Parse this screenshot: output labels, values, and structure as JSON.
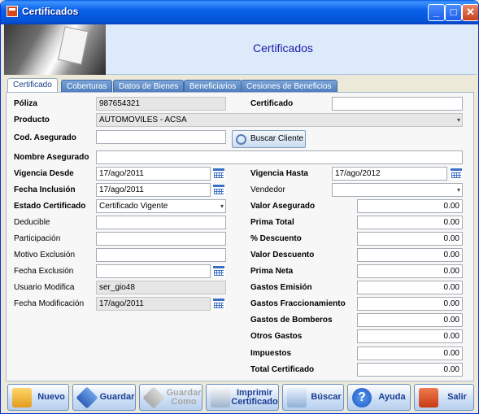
{
  "window": {
    "title": "Certificados"
  },
  "header": {
    "title": "Certificados"
  },
  "tabs": [
    "Certificado",
    "Coberturas",
    "Datos de Bienes",
    "Beneficiarios",
    "Cesiones de Beneficios"
  ],
  "form": {
    "poliza": {
      "label": "Póliza",
      "value": "987654321"
    },
    "certificado": {
      "label": "Certificado",
      "value": ""
    },
    "producto": {
      "label": "Producto",
      "value": "AUTOMOVILES - ACSA"
    },
    "cod_asegurado": {
      "label": "Cod. Asegurado",
      "value": ""
    },
    "buscar_cliente": {
      "label": "Buscar Cliente"
    },
    "nombre_asegurado": {
      "label": "Nombre Asegurado",
      "value": ""
    },
    "vigencia_desde": {
      "label": "Vigencia Desde",
      "value": "17/ago/2011"
    },
    "vigencia_hasta": {
      "label": "Vigencia Hasta",
      "value": "17/ago/2012"
    },
    "fecha_inclusion": {
      "label": "Fecha Inclusión",
      "value": "17/ago/2011"
    },
    "vendedor": {
      "label": "Vendedor",
      "value": ""
    },
    "estado_certificado": {
      "label": "Estado Certificado",
      "value": "Certificado Vigente"
    },
    "deducible": {
      "label": "Deducible",
      "value": ""
    },
    "participacion": {
      "label": "Participación",
      "value": ""
    },
    "motivo_exclusion": {
      "label": "Motivo Exclusión",
      "value": ""
    },
    "fecha_exclusion": {
      "label": "Fecha Exclusión",
      "value": ""
    },
    "usuario_modifica": {
      "label": "Usuario Modifica",
      "value": "ser_gio48"
    },
    "fecha_modificacion": {
      "label": "Fecha Modificación",
      "value": "17/ago/2011"
    }
  },
  "amounts": [
    {
      "label": "Valor Asegurado",
      "value": "0.00"
    },
    {
      "label": "Prima Total",
      "value": "0.00"
    },
    {
      "label": "% Descuento",
      "value": "0.00"
    },
    {
      "label": "Valor Descuento",
      "value": "0.00"
    },
    {
      "label": "Prima Neta",
      "value": "0.00"
    },
    {
      "label": "Gastos Emisión",
      "value": "0.00"
    },
    {
      "label": "Gastos Fraccionamiento",
      "value": "0.00"
    },
    {
      "label": "Gastos de Bomberos",
      "value": "0.00"
    },
    {
      "label": "Otros Gastos",
      "value": "0.00"
    },
    {
      "label": "Impuestos",
      "value": "0.00"
    },
    {
      "label": "Total Certificado",
      "value": "0.00"
    }
  ],
  "toolbar": {
    "nuevo": "Nuevo",
    "guardar": "Guardar",
    "guardar_como": "Guardar Como",
    "imprimir": "Imprimir Certificado",
    "buscar": "Búscar",
    "ayuda": "Ayuda",
    "salir": "Salir"
  },
  "colors": {
    "title_bar": "#0a5be0",
    "accent_text": "#1a1aa6",
    "toolbar_text": "#1c3e92"
  }
}
